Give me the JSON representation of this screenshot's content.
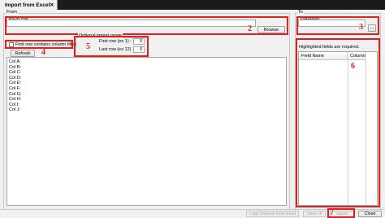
{
  "window": {
    "tab_title": "Import from Excel",
    "tab_close": "✕"
  },
  "from": {
    "caption": "From",
    "excel_file_value": "Excel File",
    "browse_label": "Browse",
    "first_row_titles_label": "First row contains column titles",
    "first_row_titles_checked": false,
    "refresh_label": "Refresh",
    "optional_range": {
      "caption": "Optional import range",
      "first_row_label": "First row (ex 1) :",
      "first_row_value": "0",
      "last_row_label": "Last row (ex 12)",
      "last_row_value": "0"
    },
    "columns": [
      "Col A:",
      "Col B:",
      "Col C:",
      "Col D:",
      "Col E:",
      "Col F:",
      "Col G:",
      "Col H:",
      "Col I:",
      "Col J:"
    ]
  },
  "to": {
    "caption": "To",
    "database_value": "Database",
    "ellipsis_label": "...",
    "highlight_note": "Highlighted fields are required.",
    "table_headers": [
      "Field Name",
      "Column"
    ]
  },
  "footer": {
    "copy_columns_label": "Copy Columns From Excel",
    "clear_all_label": "Clear All",
    "import_label": "Import",
    "close_label": "Close"
  },
  "annotations": {
    "color": "#e02020",
    "labels": [
      "2",
      "3",
      "4",
      "5",
      "6",
      "7"
    ]
  }
}
